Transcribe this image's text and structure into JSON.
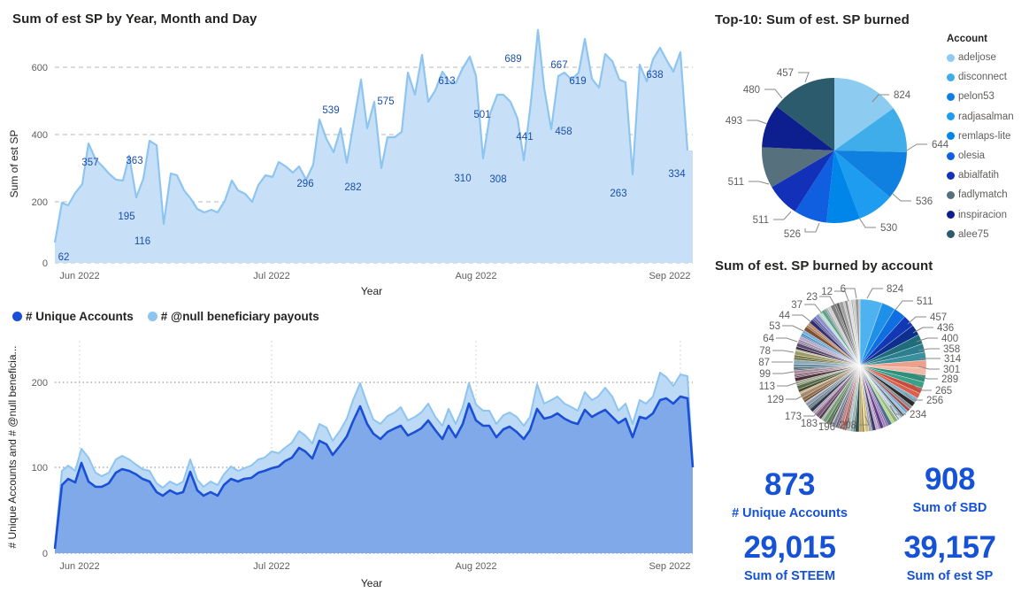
{
  "main_chart": {
    "title": "Sum of est SP by Year, Month and Day",
    "y_axis_title": "Sum of est SP",
    "x_axis_title": "Year",
    "y_ticks": [
      "0",
      "200",
      "400",
      "600"
    ],
    "x_ticks": [
      "Jun 2022",
      "Jul 2022",
      "Aug 2022",
      "Sep 2022"
    ]
  },
  "accounts_chart": {
    "legend": [
      {
        "label": "# Unique Accounts",
        "color": "#1a4fd6"
      },
      {
        "label": "# @null beneficiary payouts",
        "color": "#8ec5f0"
      }
    ],
    "y_axis_title": "# Unique Accounts and # @null beneficia...",
    "x_axis_title": "Year",
    "y_ticks": [
      "0",
      "100",
      "200"
    ],
    "x_ticks": [
      "Jun 2022",
      "Jul 2022",
      "Aug 2022",
      "Sep 2022"
    ]
  },
  "top10_pie": {
    "title": "Top-10: Sum of est. SP burned",
    "legend_title": "Account"
  },
  "account_pie": {
    "title": "Sum of est. SP burned by account"
  },
  "kpis": {
    "unique_accounts": {
      "value": "873",
      "label": "# Unique Accounts"
    },
    "sbd": {
      "value": "908",
      "label": "Sum of SBD"
    },
    "steem": {
      "value": "29,015",
      "label": "Sum of STEEM"
    },
    "est_sp": {
      "value": "39,157",
      "label": "Sum of est SP"
    }
  },
  "colors": {
    "accent": "#1552d6",
    "area_fill": "#c7e0f7",
    "area_line": "#8ec5f0",
    "dark_series": "#1a4fd6",
    "dark_fill": "#7fa9e8",
    "light_fill": "#bcd9f5",
    "label_blue": "#1b4ea8"
  },
  "chart_data": [
    {
      "type": "area",
      "name": "sum-est-sp-daily",
      "title": "Sum of est SP by Year, Month and Day",
      "xlabel": "Year",
      "ylabel": "Sum of est SP",
      "ylim": [
        0,
        700
      ],
      "grid": true,
      "x": [
        "2022-05-31",
        "2022-06-01",
        "2022-06-02",
        "2022-06-03",
        "2022-06-04",
        "2022-06-05",
        "2022-06-06",
        "2022-06-07",
        "2022-06-08",
        "2022-06-09",
        "2022-06-10",
        "2022-06-11",
        "2022-06-12",
        "2022-06-13",
        "2022-06-14",
        "2022-06-15",
        "2022-06-16",
        "2022-06-17",
        "2022-06-18",
        "2022-06-19",
        "2022-06-20",
        "2022-06-21",
        "2022-06-22",
        "2022-06-23",
        "2022-06-24",
        "2022-06-25",
        "2022-06-26",
        "2022-06-27",
        "2022-06-28",
        "2022-06-29",
        "2022-06-30",
        "2022-07-01",
        "2022-07-02",
        "2022-07-03",
        "2022-07-04",
        "2022-07-05",
        "2022-07-06",
        "2022-07-07",
        "2022-07-08",
        "2022-07-09",
        "2022-07-10",
        "2022-07-11",
        "2022-07-12",
        "2022-07-13",
        "2022-07-14",
        "2022-07-15",
        "2022-07-16",
        "2022-07-17",
        "2022-07-18",
        "2022-07-19",
        "2022-07-20",
        "2022-07-21",
        "2022-07-22",
        "2022-07-23",
        "2022-07-24",
        "2022-07-25",
        "2022-07-26",
        "2022-07-27",
        "2022-07-28",
        "2022-07-29",
        "2022-07-30",
        "2022-07-31",
        "2022-08-01",
        "2022-08-02",
        "2022-08-03",
        "2022-08-04",
        "2022-08-05",
        "2022-08-06",
        "2022-08-07",
        "2022-08-08",
        "2022-08-09",
        "2022-08-10",
        "2022-08-11",
        "2022-08-12",
        "2022-08-13",
        "2022-08-14",
        "2022-08-15",
        "2022-08-16",
        "2022-08-17",
        "2022-08-18",
        "2022-08-19",
        "2022-08-20",
        "2022-08-21",
        "2022-08-22",
        "2022-08-23",
        "2022-08-24",
        "2022-08-25",
        "2022-08-26",
        "2022-08-27",
        "2022-08-28",
        "2022-08-29",
        "2022-08-30",
        "2022-08-31",
        "2022-09-01"
      ],
      "values": [
        62,
        180,
        172,
        210,
        235,
        357,
        310,
        290,
        268,
        248,
        245,
        320,
        195,
        250,
        363,
        350,
        116,
        265,
        260,
        215,
        190,
        160,
        150,
        158,
        150,
        185,
        245,
        215,
        205,
        180,
        230,
        260,
        255,
        300,
        290,
        270,
        290,
        250,
        295,
        430,
        370,
        330,
        400,
        296,
        420,
        539,
        400,
        480,
        282,
        375,
        375,
        390,
        520,
        455,
        575,
        480,
        515,
        570,
        540,
        535,
        580,
        613,
        555,
        310,
        445,
        500,
        501,
        480,
        430,
        308,
        480,
        689,
        545,
        420,
        580,
        590,
        570,
        590,
        667,
        548,
        520,
        619,
        600,
        548,
        540,
        263,
        590,
        540,
        605,
        638,
        600,
        568,
        625,
        560,
        334
      ],
      "annotated_points": [
        {
          "x": "2022-05-31",
          "value": 62
        },
        {
          "x": "2022-06-05",
          "value": 357
        },
        {
          "x": "2022-06-12",
          "value": 195
        },
        {
          "x": "2022-06-14",
          "value": 363
        },
        {
          "x": "2022-06-16",
          "value": 116
        },
        {
          "x": "2022-07-13",
          "value": 296
        },
        {
          "x": "2022-07-15",
          "value": 539
        },
        {
          "x": "2022-07-18",
          "value": 282
        },
        {
          "x": "2022-07-24",
          "value": 575
        },
        {
          "x": "2022-07-31",
          "value": 613
        },
        {
          "x": "2022-08-02",
          "value": 310
        },
        {
          "x": "2022-08-06",
          "value": 501
        },
        {
          "x": "2022-08-09",
          "value": 308
        },
        {
          "x": "2022-08-11",
          "value": 689
        },
        {
          "x": "2022-08-13",
          "value": 441
        },
        {
          "x": "2022-08-17",
          "value": 667
        },
        {
          "x": "2022-08-19",
          "value": 458
        },
        {
          "x": "2022-08-21",
          "value": 619
        },
        {
          "x": "2022-08-25",
          "value": 263
        },
        {
          "x": "2022-08-29",
          "value": 638
        },
        {
          "x": "2022-09-01",
          "value": 334
        }
      ]
    },
    {
      "type": "area",
      "name": "unique-accounts-and-null-payouts",
      "title": "",
      "xlabel": "Year",
      "ylabel": "# Unique Accounts and # @null beneficia...",
      "ylim": [
        0,
        240
      ],
      "grid": true,
      "stacked": false,
      "x": [
        "2022-05-31",
        "2022-06-01",
        "2022-06-02",
        "2022-06-03",
        "2022-06-04",
        "2022-06-05",
        "2022-06-06",
        "2022-06-07",
        "2022-06-08",
        "2022-06-09",
        "2022-06-10",
        "2022-06-11",
        "2022-06-12",
        "2022-06-13",
        "2022-06-14",
        "2022-06-15",
        "2022-06-16",
        "2022-06-17",
        "2022-06-18",
        "2022-06-19",
        "2022-06-20",
        "2022-06-21",
        "2022-06-22",
        "2022-06-23",
        "2022-06-24",
        "2022-06-25",
        "2022-06-26",
        "2022-06-27",
        "2022-06-28",
        "2022-06-29",
        "2022-06-30",
        "2022-07-01",
        "2022-07-02",
        "2022-07-03",
        "2022-07-04",
        "2022-07-05",
        "2022-07-06",
        "2022-07-07",
        "2022-07-08",
        "2022-07-09",
        "2022-07-10",
        "2022-07-11",
        "2022-07-12",
        "2022-07-13",
        "2022-07-14",
        "2022-07-15",
        "2022-07-16",
        "2022-07-17",
        "2022-07-18",
        "2022-07-19",
        "2022-07-20",
        "2022-07-21",
        "2022-07-22",
        "2022-07-23",
        "2022-07-24",
        "2022-07-25",
        "2022-07-26",
        "2022-07-27",
        "2022-07-28",
        "2022-07-29",
        "2022-07-30",
        "2022-07-31",
        "2022-08-01",
        "2022-08-02",
        "2022-08-03",
        "2022-08-04",
        "2022-08-05",
        "2022-08-06",
        "2022-08-07",
        "2022-08-08",
        "2022-08-09",
        "2022-08-10",
        "2022-08-11",
        "2022-08-12",
        "2022-08-13",
        "2022-08-14",
        "2022-08-15",
        "2022-08-16",
        "2022-08-17",
        "2022-08-18",
        "2022-08-19",
        "2022-08-20",
        "2022-08-21",
        "2022-08-22",
        "2022-08-23",
        "2022-08-24",
        "2022-08-25",
        "2022-08-26",
        "2022-08-27",
        "2022-08-28",
        "2022-08-29",
        "2022-08-30",
        "2022-08-31",
        "2022-09-01"
      ],
      "series": [
        {
          "name": "# @null beneficiary payouts",
          "color": "#bcd9f5",
          "values": [
            7,
            96,
            103,
            96,
            122,
            112,
            94,
            90,
            94,
            110,
            114,
            110,
            104,
            99,
            96,
            82,
            77,
            84,
            80,
            84,
            110,
            86,
            78,
            84,
            80,
            92,
            101,
            96,
            99,
            103,
            110,
            112,
            119,
            118,
            124,
            130,
            144,
            139,
            129,
            152,
            148,
            133,
            144,
            158,
            180,
            200,
            176,
            158,
            152,
            162,
            166,
            172,
            156,
            160,
            166,
            176,
            160,
            150,
            170,
            152,
            172,
            200,
            175,
            168,
            168,
            152,
            162,
            166,
            160,
            150,
            160,
            198,
            176,
            180,
            184,
            176,
            172,
            168,
            190,
            180,
            186,
            196,
            186,
            170,
            176,
            152,
            180,
            176,
            184,
            212,
            206,
            196,
            208,
            205,
            105
          ]
        },
        {
          "name": "# Unique Accounts",
          "color": "#1a4fd6",
          "values": [
            5,
            80,
            87,
            83,
            106,
            84,
            78,
            78,
            82,
            94,
            98,
            96,
            92,
            87,
            84,
            72,
            68,
            74,
            70,
            72,
            96,
            74,
            68,
            72,
            68,
            80,
            87,
            84,
            87,
            88,
            94,
            96,
            100,
            102,
            108,
            112,
            124,
            120,
            112,
            132,
            128,
            116,
            126,
            138,
            155,
            172,
            152,
            140,
            134,
            142,
            146,
            150,
            138,
            142,
            146,
            156,
            144,
            134,
            150,
            136,
            152,
            176,
            156,
            150,
            150,
            136,
            145,
            148,
            142,
            134,
            144,
            170,
            158,
            160,
            164,
            158,
            154,
            152,
            168,
            160,
            164,
            172,
            164,
            152,
            158,
            136,
            160,
            158,
            164,
            180,
            182,
            176,
            184,
            182,
            100
          ]
        }
      ]
    },
    {
      "type": "pie",
      "name": "top10-est-sp-burned",
      "title": "Top-10: Sum of est. SP burned",
      "legend_title": "Account",
      "legend_position": "right",
      "labels": [
        "adeljose",
        "disconnect",
        "pelon53",
        "radjasalman",
        "remlaps-lite",
        "olesia",
        "abialfatih",
        "fadlymatch",
        "inspiracion",
        "alee75"
      ],
      "values": [
        824,
        644,
        536,
        530,
        526,
        511,
        511,
        493,
        480,
        457
      ],
      "colors": [
        "#8ecbf0",
        "#3fadea",
        "#0f7fe0",
        "#1e9df0",
        "#0086e8",
        "#0f5fe0",
        "#1230b8",
        "#57707e",
        "#0d1f8e",
        "#2d5b6e"
      ]
    },
    {
      "type": "pie",
      "name": "est-sp-burned-by-account",
      "title": "Sum of est. SP burned by account",
      "legend_position": "none",
      "labeled_values": [
        824,
        511,
        457,
        436,
        400,
        358,
        314,
        301,
        289,
        265,
        256,
        234,
        208,
        196,
        183,
        173,
        129,
        113,
        99,
        87,
        78,
        64,
        53,
        44,
        37,
        23,
        12,
        6
      ]
    }
  ]
}
